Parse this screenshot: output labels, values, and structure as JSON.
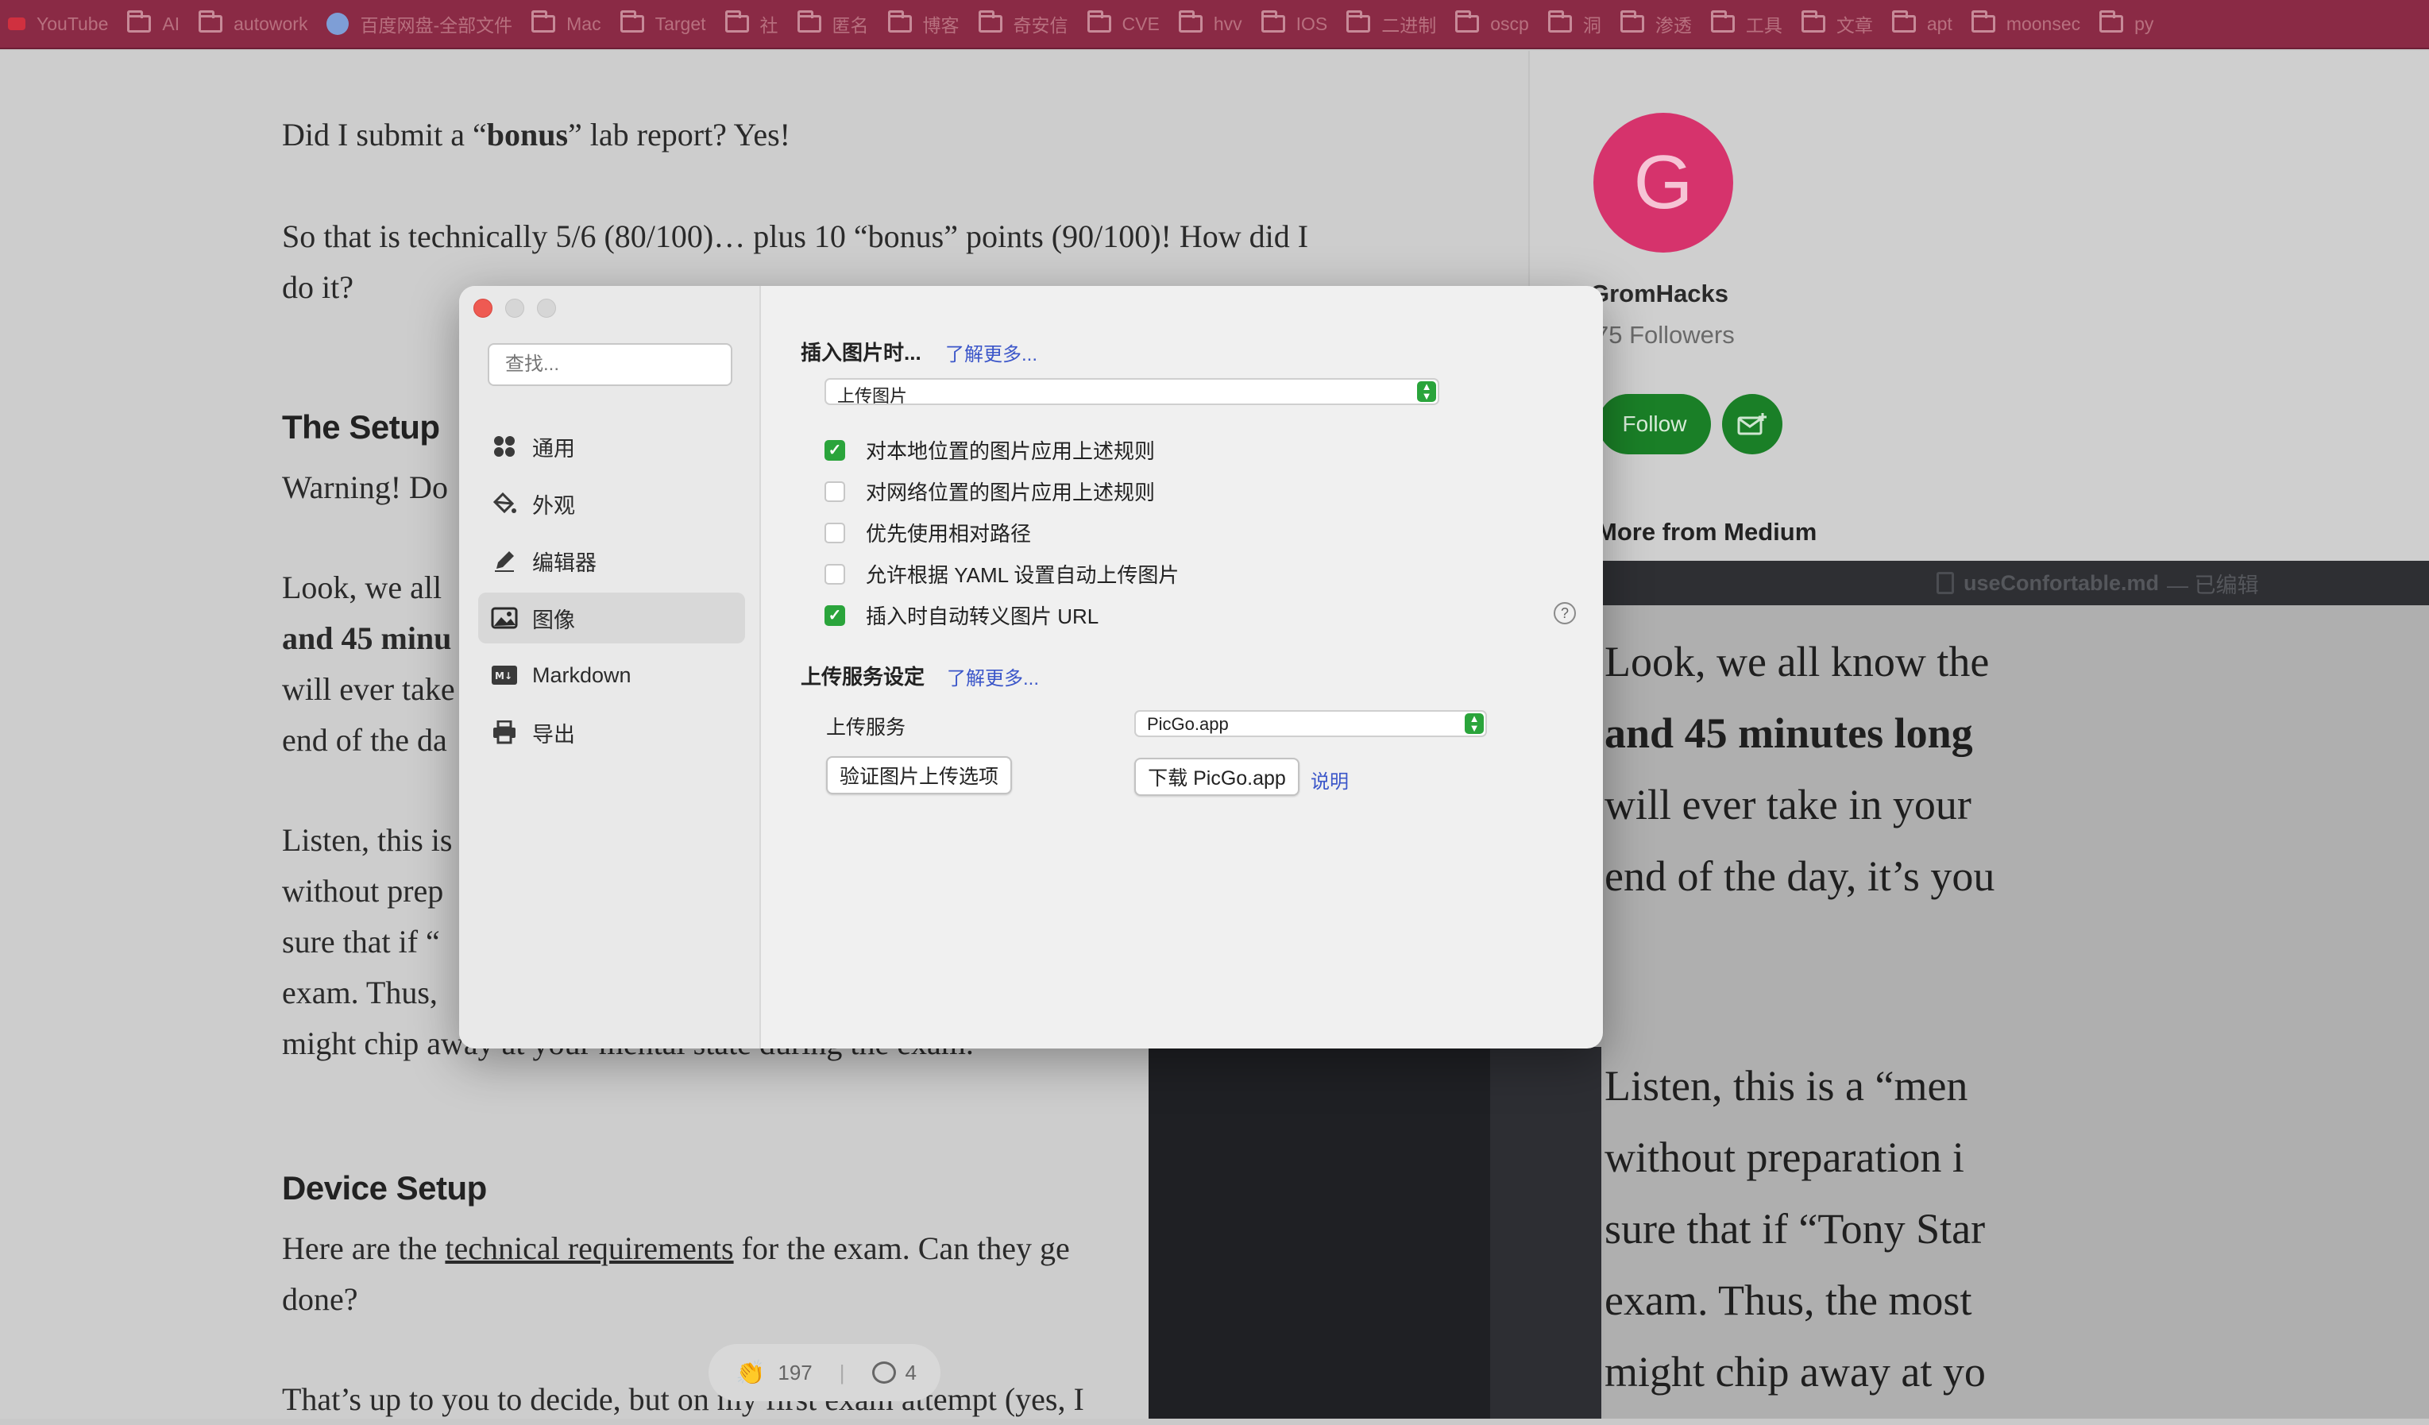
{
  "bookmarks": [
    {
      "label": "YouTube",
      "icon": "youtube-icon"
    },
    {
      "label": "AI",
      "icon": "folder-icon"
    },
    {
      "label": "autowork",
      "icon": "folder-icon"
    },
    {
      "label": "百度网盘-全部文件",
      "icon": "baidu-icon"
    },
    {
      "label": "Mac",
      "icon": "folder-icon"
    },
    {
      "label": "Target",
      "icon": "folder-icon"
    },
    {
      "label": "社",
      "icon": "folder-icon"
    },
    {
      "label": "匿名",
      "icon": "folder-icon"
    },
    {
      "label": "博客",
      "icon": "folder-icon"
    },
    {
      "label": "奇安信",
      "icon": "folder-icon"
    },
    {
      "label": "CVE",
      "icon": "folder-icon"
    },
    {
      "label": "hvv",
      "icon": "folder-icon"
    },
    {
      "label": "IOS",
      "icon": "folder-icon"
    },
    {
      "label": "二进制",
      "icon": "folder-icon"
    },
    {
      "label": "oscp",
      "icon": "folder-icon"
    },
    {
      "label": "洞",
      "icon": "folder-icon"
    },
    {
      "label": "渗透",
      "icon": "folder-icon"
    },
    {
      "label": "工具",
      "icon": "folder-icon"
    },
    {
      "label": "文章",
      "icon": "folder-icon"
    },
    {
      "label": "apt",
      "icon": "folder-icon"
    },
    {
      "label": "moonsec",
      "icon": "folder-icon"
    },
    {
      "label": "py",
      "icon": "folder-icon"
    }
  ],
  "article": {
    "p1_a": "Did I submit a “",
    "p1_b": "bonus",
    "p1_c": "” lab report? Yes!",
    "p2_line1": "So that is technically 5/6 (80/100)… plus 10 “bonus” points (90/100)! How did I",
    "p2_line2": "do it?",
    "h_setup": "The Setup",
    "setup_line": "Warning! Do",
    "look_1": "Look, we all",
    "look_2": "and 45 minu",
    "look_3": "will ever take",
    "look_4": "end of the da",
    "listen_1": "Listen, this is",
    "listen_2": "without prep",
    "listen_3": "sure that if “",
    "listen_4": "exam. Thus,",
    "listen_5": "might chip away at your mental state during the exam.",
    "h_device": "Device Setup",
    "device_a": "Here are the ",
    "device_link": "technical requirements",
    "device_b": " for the exam. Can they ge",
    "device_line2": "done?",
    "last_line": "That’s up to you to decide, but on my first exam attempt (yes, I",
    "claps": "197",
    "comments": "4"
  },
  "profile": {
    "initial": "G",
    "name": "GromHacks",
    "followers": "75 Followers",
    "follow_label": "Follow",
    "more_from": "More from Medium"
  },
  "typora": {
    "filename": "useConfortable.md",
    "status": "— 已编辑",
    "lines": [
      "Look, we all know the",
      "and 45 minutes long",
      "will ever take in your",
      "end of the day, it’s you",
      "Listen, this is a “men",
      "without preparation i",
      "sure that if “Tony Star",
      "exam. Thus, the most",
      "might chip away at yo"
    ]
  },
  "prefs": {
    "search_placeholder": "查找...",
    "nav": [
      {
        "label": "通用",
        "icon": "general-grid-icon"
      },
      {
        "label": "外观",
        "icon": "paint-bucket-icon"
      },
      {
        "label": "编辑器",
        "icon": "pen-icon"
      },
      {
        "label": "图像",
        "icon": "image-icon"
      },
      {
        "label": "Markdown",
        "icon": "markdown-icon"
      },
      {
        "label": "导出",
        "icon": "printer-icon"
      }
    ],
    "active_nav": "图像",
    "insert_title": "插入图片时...",
    "learn_more": "了解更多...",
    "insert_select": "上传图片",
    "checks": [
      {
        "label": "对本地位置的图片应用上述规则",
        "checked": true
      },
      {
        "label": "对网络位置的图片应用上述规则",
        "checked": false
      },
      {
        "label": "优先使用相对路径",
        "checked": false
      },
      {
        "label": "允许根据 YAML 设置自动上传图片",
        "checked": false
      },
      {
        "label": "插入时自动转义图片 URL",
        "checked": true
      }
    ],
    "upload_title": "上传服务设定",
    "upload_service_label": "上传服务",
    "upload_service_value": "PicGo.app",
    "verify_button": "验证图片上传选项",
    "download_button": "下载 PicGo.app",
    "explain_link": "说明",
    "help_glyph": "?"
  },
  "colors": {
    "checkbox_on": "#2aa43b",
    "link": "#3b56c9",
    "follow_green": "#1a7f27",
    "avatar": "#d6336c",
    "bookmarks_bar": "#8a2a45"
  }
}
